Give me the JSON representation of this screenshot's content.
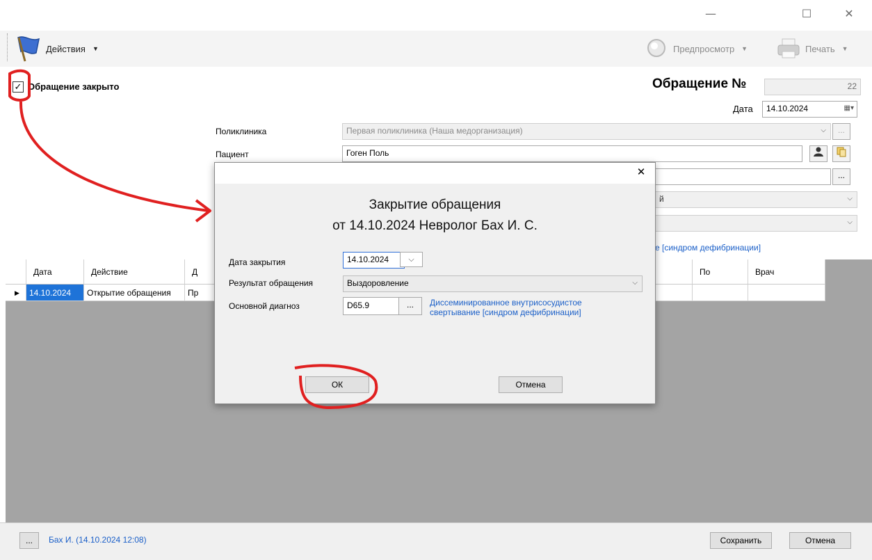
{
  "window": {
    "minimize_glyph": "—",
    "maximize_glyph": "☐",
    "close_glyph": "✕"
  },
  "toolbar": {
    "actions_label": "Действия",
    "preview_label": "Предпросмотр",
    "print_label": "Печать"
  },
  "form": {
    "closed_checkbox_label": "Обращение закрыто",
    "case_title": "Обращение №",
    "case_number": "22",
    "date_label": "Дата",
    "date_value": "14.10.2024",
    "polyclinic_label": "Поликлиника",
    "polyclinic_value": "Первая поликлиника (Наша медорганизация)",
    "patient_label": "Пациент",
    "patient_value": "Гоген Поль",
    "fragment_dropdown": "й",
    "diagnosis_link_fragment": "е [синдром дефибринации]",
    "ellipsis": "..."
  },
  "grid": {
    "columns": [
      "Дата",
      "Действие",
      "Д",
      "По",
      "Врач"
    ],
    "rows": [
      {
        "date": "14.10.2024",
        "action": "Открытие обращения",
        "d": "Пр",
        "po": "",
        "doctor": ""
      }
    ]
  },
  "footer": {
    "ellipsis": "...",
    "author_link": "Бах И. (14.10.2024 12:08)",
    "save_label": "Сохранить",
    "cancel_label": "Отмена"
  },
  "dialog": {
    "title_line1": "Закрытие обращения",
    "title_line2": "от 14.10.2024 Невролог Бах И. С.",
    "close_date_label": "Дата закрытия",
    "close_date_value": "14.10.2024",
    "result_label": "Результат обращения",
    "result_value": "Выздоровление",
    "diagnosis_label": "Основной диагноз",
    "diagnosis_code": "D65.9",
    "diagnosis_text": "Диссеминированное внутрисосудистое свертывание [синдром дефибринации]",
    "ellipsis": "...",
    "ok_label": "ОК",
    "cancel_label": "Отмена",
    "close_glyph": "✕"
  },
  "colors": {
    "link": "#1a5fc8",
    "annotation": "#e02020",
    "selected_row": "#1e73d8"
  }
}
